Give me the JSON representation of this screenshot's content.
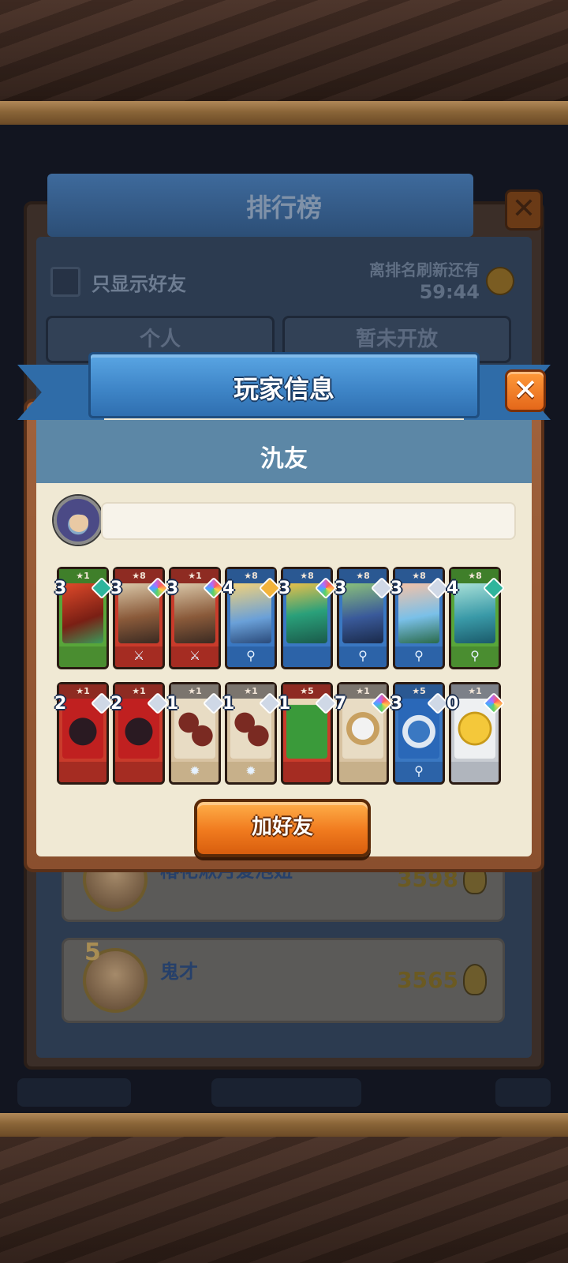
{
  "leaderboard": {
    "title": "排行榜",
    "friends_only_label": "只显示好友",
    "refresh_label": "离排名刷新还有",
    "refresh_timer": "59:44",
    "tabs": [
      "个人",
      "暂未开放"
    ],
    "rows": [
      {
        "rank": "",
        "name": "椿花湫月爱泡妞",
        "score": "3598"
      },
      {
        "rank": "5",
        "name": "鬼才",
        "score": "3565"
      }
    ]
  },
  "dialog": {
    "title": "玩家信息",
    "player_name": "氿友",
    "close_label": "✕",
    "add_friend_label": "加好友"
  },
  "cards": [
    {
      "row": 0,
      "color": "green",
      "stars": "★1",
      "count": "3",
      "gem": "teal",
      "art": "red-warrior-icon",
      "foot": ""
    },
    {
      "row": 0,
      "color": "red",
      "stars": "★8",
      "count": "3",
      "gem": "rainbow",
      "art": "knight-sword-icon",
      "foot": "⚔"
    },
    {
      "row": 0,
      "color": "red",
      "stars": "★1",
      "count": "3",
      "gem": "rainbow",
      "art": "knight-sword-icon",
      "foot": "⚔"
    },
    {
      "row": 0,
      "color": "blue",
      "stars": "★8",
      "count": "4",
      "gem": "gold",
      "art": "golden-king-icon",
      "foot": "⚲"
    },
    {
      "row": 0,
      "color": "blue",
      "stars": "★8",
      "count": "3",
      "gem": "rainbow",
      "art": "sea-dragon-icon",
      "foot": ""
    },
    {
      "row": 0,
      "color": "blue",
      "stars": "★8",
      "count": "3",
      "gem": "silver",
      "art": "pirate-icon",
      "foot": "⚲"
    },
    {
      "row": 0,
      "color": "blue",
      "stars": "★8",
      "count": "3",
      "gem": "silver",
      "art": "fairy-icon",
      "foot": "⚲"
    },
    {
      "row": 0,
      "color": "green",
      "stars": "★8",
      "count": "4",
      "gem": "teal",
      "art": "sea-goddess-icon",
      "foot": "⚲"
    },
    {
      "row": 1,
      "color": "red",
      "stars": "★1",
      "count": "2",
      "gem": "silver",
      "art": "demon-mask-icon",
      "foot": ""
    },
    {
      "row": 1,
      "color": "red",
      "stars": "★1",
      "count": "2",
      "gem": "silver",
      "art": "demon-mask-icon",
      "foot": ""
    },
    {
      "row": 1,
      "color": "tan",
      "stars": "★1",
      "count": "1",
      "gem": "silver",
      "art": "bombs-icon",
      "foot": "✹"
    },
    {
      "row": 1,
      "color": "tan",
      "stars": "★1",
      "count": "1",
      "gem": "silver",
      "art": "bombs-icon",
      "foot": "✹"
    },
    {
      "row": 1,
      "color": "red",
      "stars": "★5",
      "count": "1",
      "gem": "silver",
      "art": "green-tunic-icon",
      "foot": ""
    },
    {
      "row": 1,
      "color": "tan",
      "stars": "★1",
      "count": "7",
      "gem": "rainbow",
      "art": "shield-emblem-icon",
      "foot": ""
    },
    {
      "row": 1,
      "color": "blue",
      "stars": "★5",
      "count": "3",
      "gem": "silver",
      "art": "silver-ring-icon",
      "foot": "⚲"
    },
    {
      "row": 1,
      "color": "grey",
      "stars": "★1",
      "count": "0",
      "gem": "rainbow",
      "art": "gold-coin-icon",
      "foot": ""
    }
  ]
}
